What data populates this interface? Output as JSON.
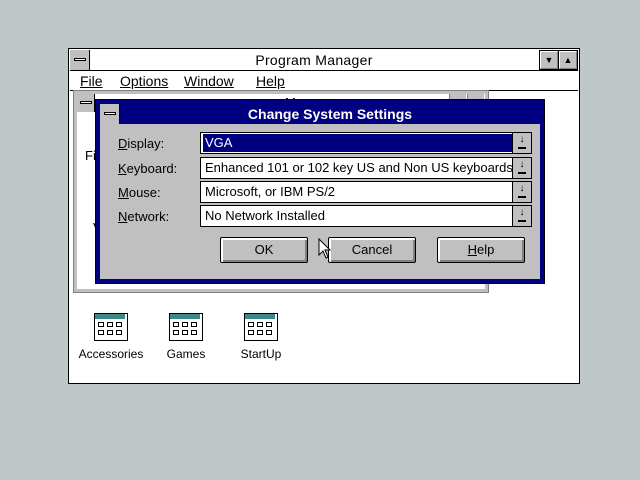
{
  "program_manager": {
    "title": "Program Manager",
    "menu": [
      {
        "label": "File"
      },
      {
        "label": "Options"
      },
      {
        "label": "Window"
      },
      {
        "label": "Help"
      }
    ],
    "control_buttons": [
      "minimize",
      "maximize"
    ]
  },
  "main_window": {
    "partial_text_1": "Fil",
    "partial_text_2": "V",
    "partial_title": "M"
  },
  "program_groups": [
    {
      "label": "Accessories",
      "icon": "program-group-icon"
    },
    {
      "label": "Games",
      "icon": "program-group-icon"
    },
    {
      "label": "StartUp",
      "icon": "program-group-icon"
    }
  ],
  "dialog": {
    "title": "Change System Settings",
    "fields": [
      {
        "label": "Display:",
        "value": "VGA",
        "selected": true
      },
      {
        "label": "Keyboard:",
        "value": "Enhanced 101 or 102 key US and Non US keyboards"
      },
      {
        "label": "Mouse:",
        "value": "Microsoft, or IBM PS/2"
      },
      {
        "label": "Network:",
        "value": "No Network Installed"
      }
    ],
    "buttons": {
      "ok": "OK",
      "cancel": "Cancel",
      "help": "Help"
    }
  },
  "colors": {
    "desktop": "#c0c7c8",
    "dialog_title_bar": "#000080",
    "selection": "#000080",
    "window_face": "#c0c0c0"
  }
}
